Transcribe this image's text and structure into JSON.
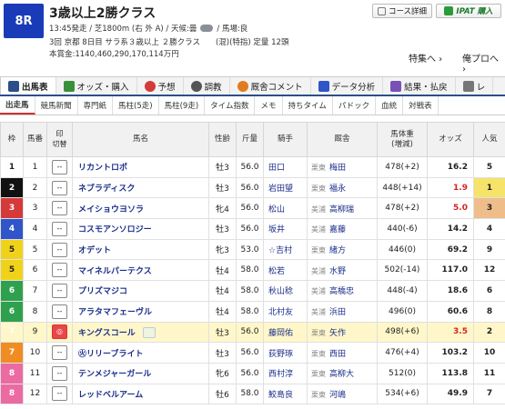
{
  "race": {
    "number": "8R",
    "title": "3歳以上2勝クラス",
    "meta_line1_a": "13:45発走 / 芝1800m (右 外 A) / 天候:曇",
    "meta_line1_b": "/ 馬場:良",
    "meta_line2": "3回 京都 8日目 サラ系３歳以上 ２勝クラス　　(混)(特指) 定量 12頭",
    "meta_line3": "本賞金:1140,460,290,170,114万円"
  },
  "header_buttons": {
    "course": "コース詳細",
    "ipat": "IPAT 購入"
  },
  "links": {
    "special": "特集へ ›",
    "last_race": "俺プロへ ›"
  },
  "main_tabs": [
    {
      "label": "出馬表",
      "icon": "table-icon",
      "color": "#2a4f8a"
    },
    {
      "label": "オッズ・購入",
      "icon": "chart-icon",
      "color": "#3a8f3a"
    },
    {
      "label": "予想",
      "icon": "target-icon",
      "color": "#d43a3a"
    },
    {
      "label": "調教",
      "icon": "stopwatch-icon",
      "color": "#555"
    },
    {
      "label": "厩舎コメント",
      "icon": "comment-icon",
      "color": "#e07b1f"
    },
    {
      "label": "データ分析",
      "icon": "data-icon",
      "color": "#2f55c9"
    },
    {
      "label": "結果・払戻",
      "icon": "result-icon",
      "color": "#7a4fb8"
    },
    {
      "label": "レ",
      "icon": "replay-icon",
      "color": "#777"
    }
  ],
  "sub_tabs": [
    "出走馬",
    "競馬新聞",
    "専門紙",
    "馬柱(5走)",
    "馬柱(9走)",
    "タイム指数",
    "メモ",
    "持ちタイム",
    "パドック",
    "血統",
    "対戦表"
  ],
  "table": {
    "headers": {
      "waku": "枠",
      "umaban": "馬番",
      "mark_a": "印",
      "mark_b": "切替",
      "horse": "馬名",
      "sex_age": "性齢",
      "weight": "斤量",
      "jockey": "騎手",
      "trainer": "厩舎",
      "body_weight_a": "馬体重",
      "body_weight_b": "(増減)",
      "odds": "オッズ",
      "popularity": "人気"
    },
    "rows": [
      {
        "waku": "1",
        "umaban": "1",
        "mark": "--",
        "horse": "リカントロポ",
        "sex_age": "牡3",
        "weight": "56.0",
        "jockey": "田口",
        "stable": "栗東",
        "trainer": "梅田",
        "body_weight": "478(+2)",
        "odds": "16.2",
        "pop": "5"
      },
      {
        "waku": "2",
        "umaban": "2",
        "mark": "--",
        "horse": "ネブラディスク",
        "sex_age": "牡3",
        "weight": "56.0",
        "jockey": "岩田望",
        "stable": "栗東",
        "trainer": "福永",
        "body_weight": "448(+14)",
        "odds": "1.9",
        "pop": "1"
      },
      {
        "waku": "3",
        "umaban": "3",
        "mark": "--",
        "horse": "メイショウヨソラ",
        "sex_age": "牝4",
        "weight": "56.0",
        "jockey": "松山",
        "stable": "美浦",
        "trainer": "高柳瑞",
        "body_weight": "478(+2)",
        "odds": "5.0",
        "pop": "3"
      },
      {
        "waku": "4",
        "umaban": "4",
        "mark": "--",
        "horse": "コスモアンソロジー",
        "sex_age": "牡3",
        "weight": "56.0",
        "jockey": "坂井",
        "stable": "美浦",
        "trainer": "嘉藤",
        "body_weight": "440(-6)",
        "odds": "14.2",
        "pop": "4"
      },
      {
        "waku": "5",
        "umaban": "5",
        "mark": "--",
        "horse": "オデット",
        "sex_age": "牝3",
        "weight": "53.0",
        "jockey": "☆吉村",
        "stable": "栗東",
        "trainer": "緒方",
        "body_weight": "446(0)",
        "odds": "69.2",
        "pop": "9"
      },
      {
        "waku": "5",
        "umaban": "6",
        "mark": "--",
        "horse": "マイネルパーテクス",
        "sex_age": "牡4",
        "weight": "58.0",
        "jockey": "松若",
        "stable": "美浦",
        "trainer": "水野",
        "body_weight": "502(-14)",
        "odds": "117.0",
        "pop": "12"
      },
      {
        "waku": "6",
        "umaban": "7",
        "mark": "--",
        "horse": "プリズマジコ",
        "sex_age": "牡4",
        "weight": "58.0",
        "jockey": "秋山稔",
        "stable": "美浦",
        "trainer": "高橋忠",
        "body_weight": "448(-4)",
        "odds": "18.6",
        "pop": "6"
      },
      {
        "waku": "6",
        "umaban": "8",
        "mark": "--",
        "horse": "アラタマフェーヴル",
        "sex_age": "牡4",
        "weight": "58.0",
        "jockey": "北村友",
        "stable": "美浦",
        "trainer": "浜田",
        "body_weight": "496(0)",
        "odds": "60.6",
        "pop": "8"
      },
      {
        "waku": "7",
        "umaban": "9",
        "mark": "◎",
        "horse": "キングスコール",
        "sex_age": "牡3",
        "weight": "56.0",
        "jockey": "藤岡佑",
        "stable": "栗東",
        "trainer": "矢作",
        "body_weight": "498(+6)",
        "odds": "3.5",
        "pop": "2",
        "highlight": true
      },
      {
        "waku": "7",
        "umaban": "10",
        "mark": "--",
        "horse": "㊋リリーブライト",
        "sex_age": "牡3",
        "weight": "56.0",
        "jockey": "荻野琢",
        "stable": "栗東",
        "trainer": "西田",
        "body_weight": "476(+4)",
        "odds": "103.2",
        "pop": "10"
      },
      {
        "waku": "8",
        "umaban": "11",
        "mark": "--",
        "horse": "テンメジャーガール",
        "sex_age": "牝6",
        "weight": "56.0",
        "jockey": "西村淳",
        "stable": "栗東",
        "trainer": "高柳大",
        "body_weight": "512(0)",
        "odds": "113.8",
        "pop": "11"
      },
      {
        "waku": "8",
        "umaban": "12",
        "mark": "--",
        "horse": "レッドベルアーム",
        "sex_age": "牡6",
        "weight": "58.0",
        "jockey": "鮫島良",
        "stable": "栗東",
        "trainer": "河嶋",
        "body_weight": "534(+6)",
        "odds": "49.9",
        "pop": "7"
      }
    ]
  },
  "colors": {
    "accent": "#1a3bb8",
    "odds_hot": "#d42424"
  }
}
